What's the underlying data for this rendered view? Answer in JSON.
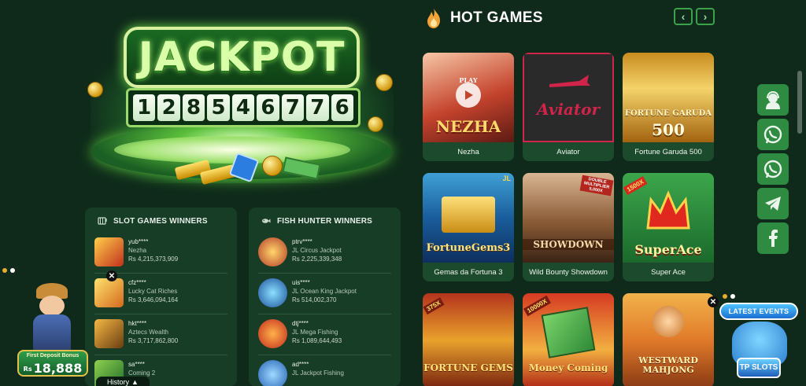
{
  "jackpot": {
    "title": "JACKPOT",
    "digits": [
      "1",
      "2",
      "8",
      "5",
      "4",
      "6",
      "7",
      "7",
      "6"
    ]
  },
  "slot_winners": {
    "title": "SLOT GAMES WINNERS",
    "items": [
      {
        "user": "yub****",
        "game": "Nezha",
        "amount": "Rs 4,215,373,909"
      },
      {
        "user": "cfz****",
        "game": "Lucky Cat Riches",
        "amount": "Rs 3,646,094,164"
      },
      {
        "user": "hkt****",
        "game": "Aztecs Wealth",
        "amount": "Rs 3,717,862,800"
      },
      {
        "user": "sa****",
        "game": "Coming 2",
        "amount": ""
      }
    ]
  },
  "fish_winners": {
    "title": "FISH HUNTER WINNERS",
    "items": [
      {
        "user": "ptrv****",
        "game": "JL Circus Jackpot",
        "amount": "Rs 2,225,339,348"
      },
      {
        "user": "uis****",
        "game": "JL Ocean King Jackpot",
        "amount": "Rs 514,002,370"
      },
      {
        "user": "dtj****",
        "game": "JL Mega Fishing",
        "amount": "Rs 1,089,644,493"
      },
      {
        "user": "ad****",
        "game": "JL Jackpot Fishing",
        "amount": ""
      }
    ]
  },
  "hot_games": {
    "title": "HOT GAMES",
    "prev": "‹",
    "next": "›",
    "games": [
      {
        "label": "Nezha",
        "art": "NEZHA",
        "play": "PLAY"
      },
      {
        "label": "Aviator",
        "art": "Aviator"
      },
      {
        "label": "Fortune Garuda 500",
        "art": "FORTUNE GARUDA",
        "art2": "500"
      },
      {
        "label": "Gemas da Fortuna 3",
        "art": "FortuneGems3",
        "badge": "JL"
      },
      {
        "label": "Wild Bounty Showdown",
        "art": "SHOWDOWN",
        "badge": "DOUBLE MULTIPLIER 5,000X"
      },
      {
        "label": "Super Ace",
        "art": "SuperAce",
        "badge": "1500X"
      },
      {
        "art": "FORTUNE GEMS",
        "badge": "375X"
      },
      {
        "art": "Money Coming",
        "badge": "10000X"
      },
      {
        "art": "WESTWARD MAHJONG"
      }
    ]
  },
  "promo": {
    "label": "First Deposit Bonus",
    "currency": "Rs",
    "amount": "18,888"
  },
  "events": {
    "banner": "LATEST EVENTS",
    "tag": "TP SLOTS"
  },
  "history": {
    "label": "History"
  },
  "colors": {
    "background": "#0f2a1b",
    "panel": "#173d26",
    "accent": "#2f8a42"
  }
}
